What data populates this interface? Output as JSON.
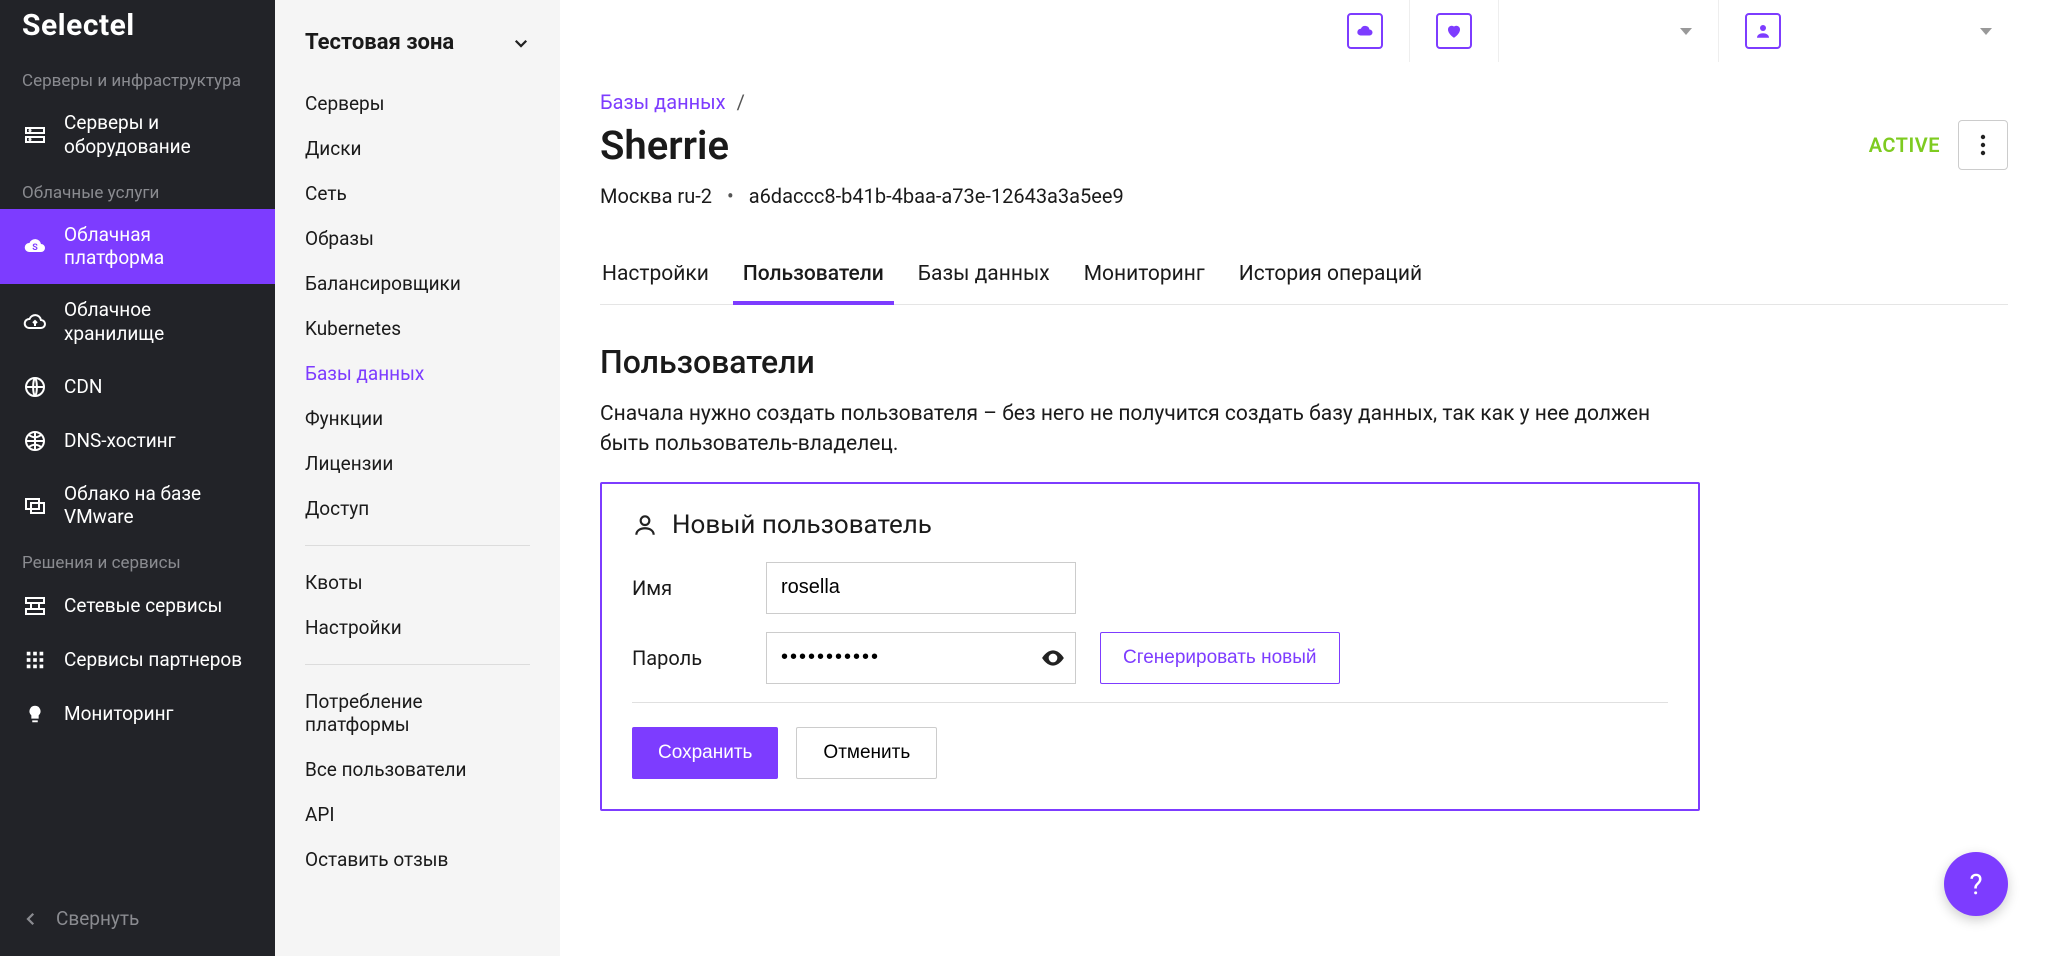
{
  "logo_text": "Selectel",
  "sidebar": {
    "section1_label": "Серверы и инфраструктура",
    "section2_label": "Облачные услуги",
    "section3_label": "Решения и сервисы",
    "items_servers": "Серверы и оборудование",
    "items_cloud_platform": "Облачная платформа",
    "items_cloud_storage": "Облачное хранилище",
    "items_cdn": "CDN",
    "items_dns": "DNS-хостинг",
    "items_vmware": "Облако на базе VMware",
    "items_network": "Сетевые сервисы",
    "items_partners": "Сервисы партнеров",
    "items_monitoring": "Мониторинг",
    "collapse": "Свернуть"
  },
  "subnav": {
    "zone_title": "Тестовая зона",
    "items": {
      "servers": "Серверы",
      "disks": "Диски",
      "network": "Сеть",
      "images": "Образы",
      "balancers": "Балансировщики",
      "kubernetes": "Kubernetes",
      "databases": "Базы данных",
      "functions": "Функции",
      "licenses": "Лицензии",
      "access": "Доступ",
      "quotas": "Квоты",
      "settings": "Настройки",
      "consumption": "Потребление платформы",
      "all_users": "Все пользователи",
      "api": "API",
      "feedback": "Оставить отзыв"
    }
  },
  "breadcrumb": {
    "root": "Базы данных",
    "sep": "/"
  },
  "page": {
    "title": "Sherrie",
    "status": "ACTIVE",
    "region": "Москва ru-2",
    "dot": "•",
    "uuid": "a6daccc8-b41b-4baa-a73e-12643a3a5ee9"
  },
  "tabs": {
    "settings": "Настройки",
    "users": "Пользователи",
    "databases": "Базы данных",
    "monitoring": "Мониторинг",
    "history": "История операций"
  },
  "section": {
    "title": "Пользователи",
    "desc": "Сначала нужно создать пользователя – без него не получится создать базу данных, так как у нее должен быть пользователь-владелец."
  },
  "form": {
    "header": "Новый пользователь",
    "name_label": "Имя",
    "name_value": "rosella",
    "password_label": "Пароль",
    "password_value": "•••••••••••",
    "generate": "Сгенерировать новый",
    "save": "Сохранить",
    "cancel": "Отменить"
  },
  "help": "?"
}
